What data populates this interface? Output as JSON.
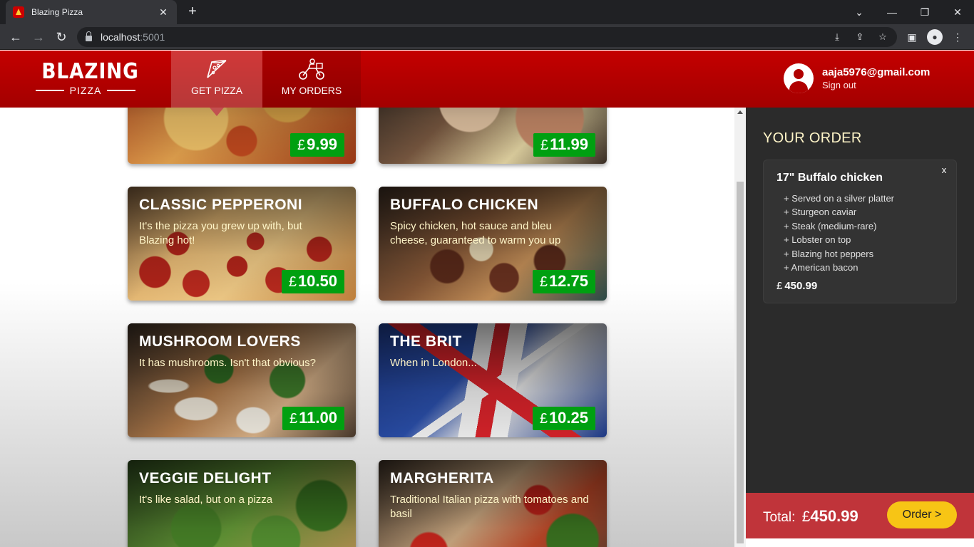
{
  "browser": {
    "tab_title": "Blazing Pizza",
    "url_host": "localhost",
    "url_port": ":5001"
  },
  "header": {
    "logo_top": "BLAZING",
    "logo_bottom": "PIZZA",
    "nav": [
      {
        "label": "GET PIZZA",
        "icon": "pizza-slice-icon",
        "active": true
      },
      {
        "label": "MY ORDERS",
        "icon": "delivery-bike-icon",
        "active": false
      }
    ],
    "user": {
      "email": "aaja5976@gmail.com",
      "sign_out": "Sign out"
    }
  },
  "specials": [
    {
      "name": "",
      "description": "",
      "currency": "£",
      "price": "9.99",
      "image": "pizza-image"
    },
    {
      "name": "",
      "description": "",
      "currency": "£",
      "price": "11.99",
      "image": "meat-pizza-image"
    },
    {
      "name": "CLASSIC PEPPERONI",
      "description": "It's the pizza you grew up with, but Blazing hot!",
      "currency": "£",
      "price": "10.50",
      "image": "pepperoni-pizza-image"
    },
    {
      "name": "BUFFALO CHICKEN",
      "description": "Spicy chicken, hot sauce and bleu cheese, guaranteed to warm you up",
      "currency": "£",
      "price": "12.75",
      "image": "buffalo-chicken-pizza-image"
    },
    {
      "name": "MUSHROOM LOVERS",
      "description": "It has mushrooms. Isn't that obvious?",
      "currency": "£",
      "price": "11.00",
      "image": "mushroom-pizza-image"
    },
    {
      "name": "THE BRIT",
      "description": "When in London...",
      "currency": "£",
      "price": "10.25",
      "image": "union-jack-image"
    },
    {
      "name": "VEGGIE DELIGHT",
      "description": "It's like salad, but on a pizza",
      "currency": "£",
      "price": "",
      "image": "veggie-pizza-image"
    },
    {
      "name": "MARGHERITA",
      "description": "Traditional Italian pizza with tomatoes and basil",
      "currency": "£",
      "price": "",
      "image": "margherita-pizza-image"
    }
  ],
  "order": {
    "title": "YOUR ORDER",
    "item": {
      "name": "17\" Buffalo chicken",
      "remove": "x",
      "toppings": [
        "+ Served on a silver platter",
        "+ Sturgeon caviar",
        "+ Steak (medium-rare)",
        "+ Lobster on top",
        "+ Blazing hot peppers",
        "+ American bacon"
      ],
      "currency": "£",
      "price": "450.99"
    },
    "total_label": "Total:",
    "total_currency": "£",
    "total_value": "450.99",
    "order_button": "Order >"
  },
  "colors": {
    "brand_red": "#c40000",
    "price_green": "#00a011",
    "order_button": "#f7c515",
    "sidebar_bg": "#2b2b2b",
    "footer_red": "#c0343a"
  }
}
